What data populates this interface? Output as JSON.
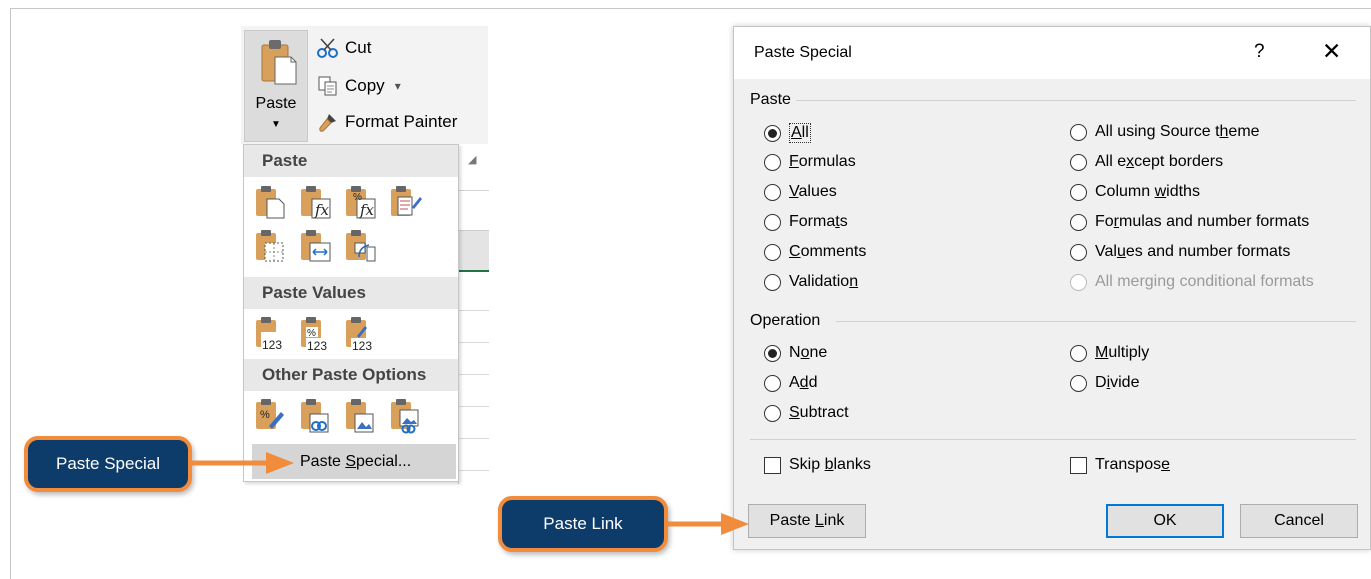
{
  "ribbon": {
    "paste_label": "Paste",
    "cut_label": "Cut",
    "copy_label": "Copy",
    "copy_caret": "▾",
    "format_painter_label": "Format Painter"
  },
  "menu": {
    "section_paste": "Paste",
    "section_paste_values": "Paste Values",
    "section_other": "Other Paste Options",
    "paste_special_label": "Paste Special...",
    "paste_special_underline": "S",
    "value_badge": "123"
  },
  "dialog": {
    "title": "Paste Special",
    "help": "?",
    "close": "✕",
    "paste_group": "Paste",
    "operation_group": "Operation",
    "paste_options_left": [
      {
        "pre": "",
        "u": "A",
        "post": "ll",
        "checked": true
      },
      {
        "pre": "",
        "u": "F",
        "post": "ormulas",
        "checked": false
      },
      {
        "pre": "",
        "u": "V",
        "post": "alues",
        "checked": false
      },
      {
        "pre": "Forma",
        "u": "t",
        "post": "s",
        "checked": false
      },
      {
        "pre": "",
        "u": "C",
        "post": "omments",
        "checked": false
      },
      {
        "pre": "Validatio",
        "u": "n",
        "post": "",
        "checked": false
      }
    ],
    "paste_options_right": [
      {
        "pre": "All using Source t",
        "u": "h",
        "post": "eme",
        "disabled": false
      },
      {
        "pre": "All e",
        "u": "x",
        "post": "cept borders",
        "disabled": false
      },
      {
        "pre": "Column ",
        "u": "w",
        "post": "idths",
        "disabled": false
      },
      {
        "pre": "Fo",
        "u": "r",
        "post": "mulas and number formats",
        "disabled": false
      },
      {
        "pre": "Val",
        "u": "u",
        "post": "es and number formats",
        "disabled": false
      },
      {
        "pre": "All merging conditional formats",
        "u": "",
        "post": "",
        "disabled": true
      }
    ],
    "operation_left": [
      {
        "pre": "N",
        "u": "o",
        "post": "ne",
        "checked": true
      },
      {
        "pre": "A",
        "u": "d",
        "post": "d",
        "checked": false
      },
      {
        "pre": "",
        "u": "S",
        "post": "ubtract",
        "checked": false
      }
    ],
    "operation_right": [
      {
        "pre": "",
        "u": "M",
        "post": "ultiply",
        "checked": false
      },
      {
        "pre": "D",
        "u": "i",
        "post": "vide",
        "checked": false
      }
    ],
    "skip_blanks": {
      "pre": "Skip ",
      "u": "b",
      "post": "lanks"
    },
    "transpose": {
      "pre": "Transpos",
      "u": "e",
      "post": ""
    },
    "paste_link_btn": {
      "pre": "Paste ",
      "u": "L",
      "post": "ink"
    },
    "ok_btn": "OK",
    "cancel_btn": "Cancel"
  },
  "callouts": {
    "paste_special": "Paste Special",
    "paste_link": "Paste Link"
  },
  "colors": {
    "callout_fill": "#0d3c6b",
    "callout_border": "#f08c3c",
    "arrow": "#f08c3c",
    "ok_border": "#0078d7",
    "clipboard": "#d9a05b"
  }
}
